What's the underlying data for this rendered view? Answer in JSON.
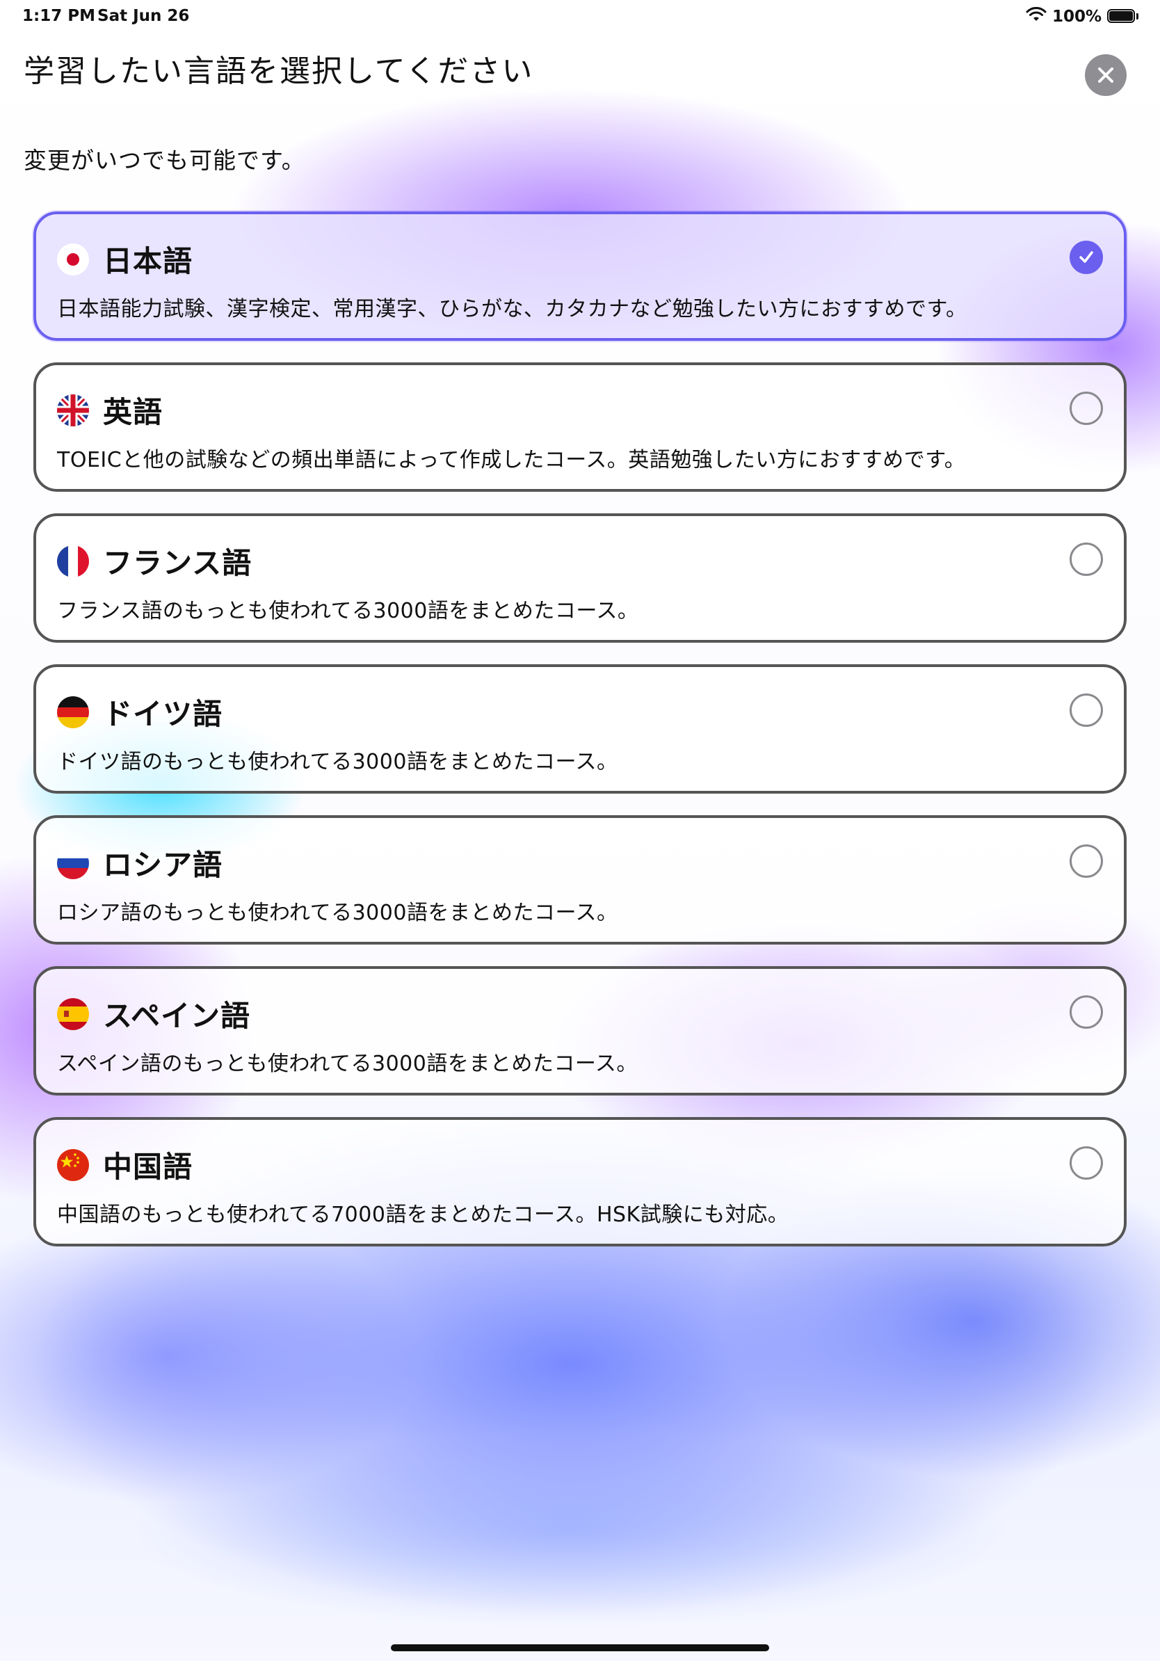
{
  "status_bar": {
    "time": "1:17 PM",
    "date": "Sat Jun 26",
    "battery_percent": "100%",
    "battery_level": 1.0,
    "icons": [
      "wifi-icon",
      "battery-icon"
    ]
  },
  "header": {
    "title": "学習したい言語を選択してください",
    "subtitle": "変更がいつでも可能です。",
    "close_icon": "close-icon"
  },
  "colors": {
    "accent": "#6b5ff0",
    "card_border": "#555555",
    "close_button": "#8e8e93"
  },
  "languages": [
    {
      "name": "日本語",
      "description": "日本語能力試験、漢字検定、常用漢字、ひらがな、カタカナなど勉強したい方におすすめです。",
      "flag": "japan-flag-icon",
      "selected": true
    },
    {
      "name": "英語",
      "description": "TOEICと他の試験などの頻出単語によって作成したコース。英語勉強したい方におすすめです。",
      "flag": "uk-flag-icon",
      "selected": false
    },
    {
      "name": "フランス語",
      "description": "フランス語のもっとも使われてる3000語をまとめたコース。",
      "flag": "france-flag-icon",
      "selected": false
    },
    {
      "name": "ドイツ語",
      "description": "ドイツ語のもっとも使われてる3000語をまとめたコース。",
      "flag": "germany-flag-icon",
      "selected": false
    },
    {
      "name": "ロシア語",
      "description": "ロシア語のもっとも使われてる3000語をまとめたコース。",
      "flag": "russia-flag-icon",
      "selected": false
    },
    {
      "name": "スペイン語",
      "description": "スペイン語のもっとも使われてる3000語をまとめたコース。",
      "flag": "spain-flag-icon",
      "selected": false
    },
    {
      "name": "中国語",
      "description": "中国語のもっとも使われてる7000語をまとめたコース。HSK試験にも対応。",
      "flag": "china-flag-icon",
      "selected": false
    }
  ]
}
